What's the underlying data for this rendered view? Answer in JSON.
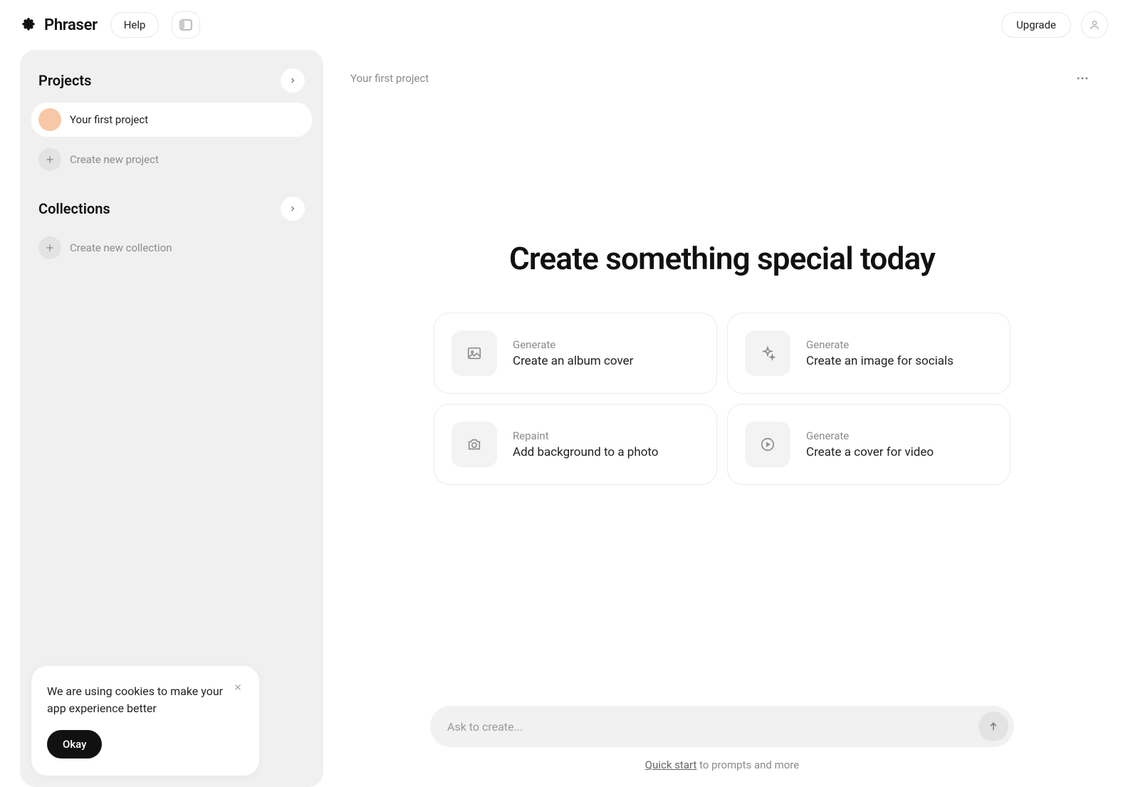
{
  "header": {
    "logo_text": "Phraser",
    "help_label": "Help",
    "upgrade_label": "Upgrade"
  },
  "sidebar": {
    "projects_heading": "Projects",
    "collections_heading": "Collections",
    "project_item_label": "Your first project",
    "create_project_label": "Create new project",
    "create_collection_label": "Create new collection"
  },
  "cookie": {
    "message": "We are using cookies to make your app experience better",
    "okay_label": "Okay"
  },
  "main": {
    "breadcrumb": "Your first project",
    "hero_title": "Create something special today",
    "cards": [
      {
        "kicker": "Generate",
        "title": "Create an album cover"
      },
      {
        "kicker": "Generate",
        "title": "Create an image for socials"
      },
      {
        "kicker": "Repaint",
        "title": "Add background to a photo"
      },
      {
        "kicker": "Generate",
        "title": "Create a cover for video"
      }
    ],
    "prompt_placeholder": "Ask to create...",
    "quick_start_link": "Quick start",
    "quick_start_rest": " to prompts and more"
  }
}
